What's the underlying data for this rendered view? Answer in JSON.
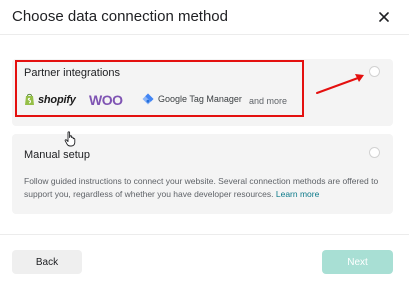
{
  "dialog": {
    "title": "Choose data connection method"
  },
  "options": {
    "partner": {
      "heading": "Partner integrations",
      "logos": {
        "shopify": "shopify",
        "woo": "WOO",
        "gtm": "Google Tag Manager"
      },
      "and_more": "and more"
    },
    "manual": {
      "heading": "Manual setup",
      "description": "Follow guided instructions to connect your website. Several connection methods are offered to support you, regardless of whether you have developer resources.",
      "learn_more": "Learn more"
    }
  },
  "footer": {
    "back_label": "Back",
    "next_label": "Next"
  },
  "icons": {
    "close": "close-icon",
    "shopify": "shopify-bag-icon",
    "gtm": "gtm-diamond-icon",
    "cursor": "hand-cursor-icon"
  },
  "colors": {
    "annotation": "#e4100f",
    "woo": "#7f54b3",
    "link": "#0d7a8a",
    "next_button_disabled": "#a8dfd4"
  }
}
